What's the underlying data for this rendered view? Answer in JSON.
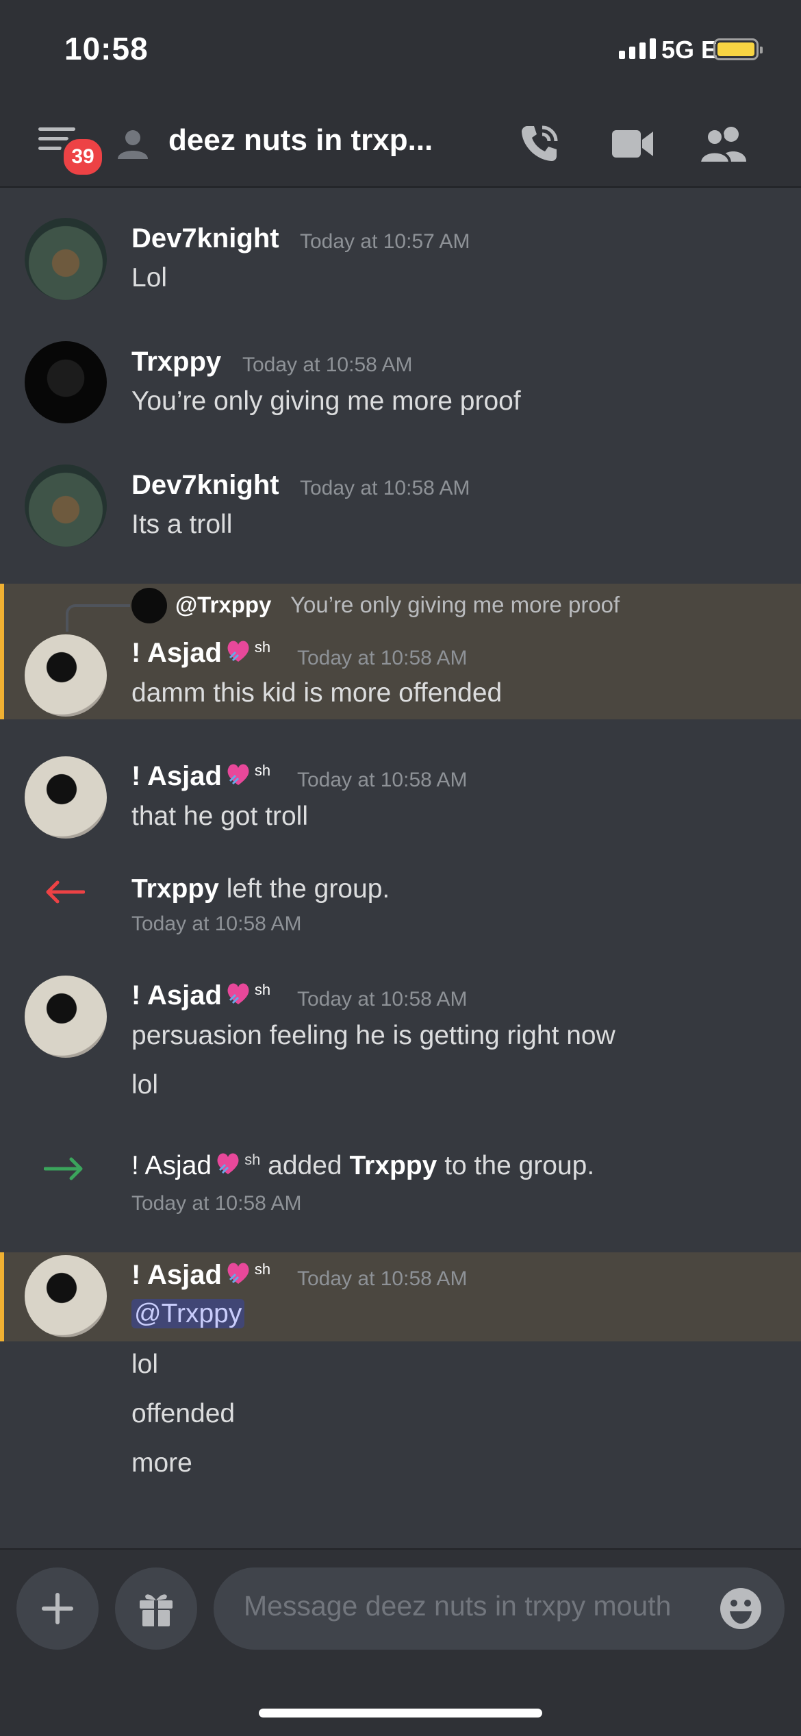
{
  "status_bar": {
    "time": "10:58",
    "network": "5G E"
  },
  "header": {
    "badge_count": "39",
    "channel_title": "deez nuts in trxp..."
  },
  "messages": [
    {
      "author": "Dev7knight",
      "time": "Today at 10:57 AM",
      "lines": [
        "Lol"
      ]
    },
    {
      "author": "Trxppy",
      "time": "Today at 10:58 AM",
      "lines": [
        "You’re only giving me more proof"
      ]
    },
    {
      "author": "Dev7knight",
      "time": "Today at 10:58 AM",
      "lines": [
        "Its a troll"
      ]
    },
    {
      "author": "! Asjad",
      "author_suffix": "sh",
      "time": "Today at 10:58 AM",
      "reply": {
        "author": "@Trxppy",
        "text": "You’re only giving me more proof"
      },
      "lines": [
        "damm this kid is more offended"
      ]
    },
    {
      "author": "! Asjad",
      "author_suffix": "sh",
      "time": "Today at 10:58 AM",
      "lines": [
        "that he got troll"
      ]
    },
    {
      "author": "! Asjad",
      "author_suffix": "sh",
      "time": "Today at 10:58 AM",
      "lines": [
        "persuasion feeling he is getting right now",
        "lol"
      ]
    },
    {
      "author": "! Asjad",
      "author_suffix": "sh",
      "time": "Today at 10:58 AM",
      "mention": "@Trxppy",
      "lines": [
        "lol",
        "offended",
        "more"
      ]
    }
  ],
  "system_messages": [
    {
      "user": "Trxppy",
      "action": "left the group.",
      "time": "Today at 10:58 AM"
    },
    {
      "user": "! Asjad",
      "user_suffix": "sh",
      "verb": "added",
      "target": "Trxppy",
      "action": "to the group.",
      "time": "Today at 10:58 AM"
    }
  ],
  "composer": {
    "placeholder": "Message deez nuts in trxpy mouth"
  },
  "colors": {
    "background": "#36393f",
    "highlight": "#4b4740",
    "highlight_bar": "#f0b132",
    "leave": "#ed4245",
    "join": "#3ba55c",
    "mention_bg": "#414675"
  }
}
